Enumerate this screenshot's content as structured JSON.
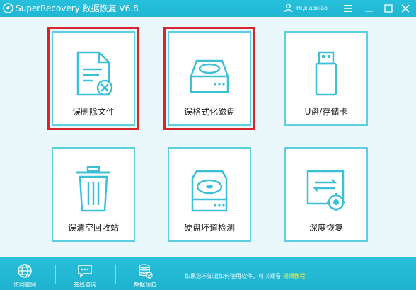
{
  "app": {
    "title": "SuperRecovery 数据恢复 V6.8",
    "username": "Hi,xiaoxiao"
  },
  "tiles": [
    {
      "label": "误删除文件",
      "icon": "deleted-file-icon",
      "highlighted": true
    },
    {
      "label": "误格式化磁盘",
      "icon": "disk-icon",
      "highlighted": true
    },
    {
      "label": "U盘/存储卡",
      "icon": "usb-drive-icon",
      "highlighted": false
    },
    {
      "label": "误清空回收站",
      "icon": "recycle-bin-icon",
      "highlighted": false
    },
    {
      "label": "硬盘坏道检测",
      "icon": "hard-drive-scan-icon",
      "highlighted": false
    },
    {
      "label": "深度恢复",
      "icon": "deep-recovery-icon",
      "highlighted": false
    }
  ],
  "bottom": {
    "items": [
      {
        "label": "访问官网",
        "icon": "globe-icon"
      },
      {
        "label": "在线咨询",
        "icon": "chat-icon"
      },
      {
        "label": "数据预防",
        "icon": "database-icon"
      }
    ],
    "notice": "如果您不知道如何使用软件，可以观看",
    "notice_link": "视频教程"
  },
  "colors": {
    "accent": "#20b6d4",
    "tile_border": "#5ecfe1",
    "highlight_border": "#d4282e",
    "link": "#ffea3c"
  }
}
